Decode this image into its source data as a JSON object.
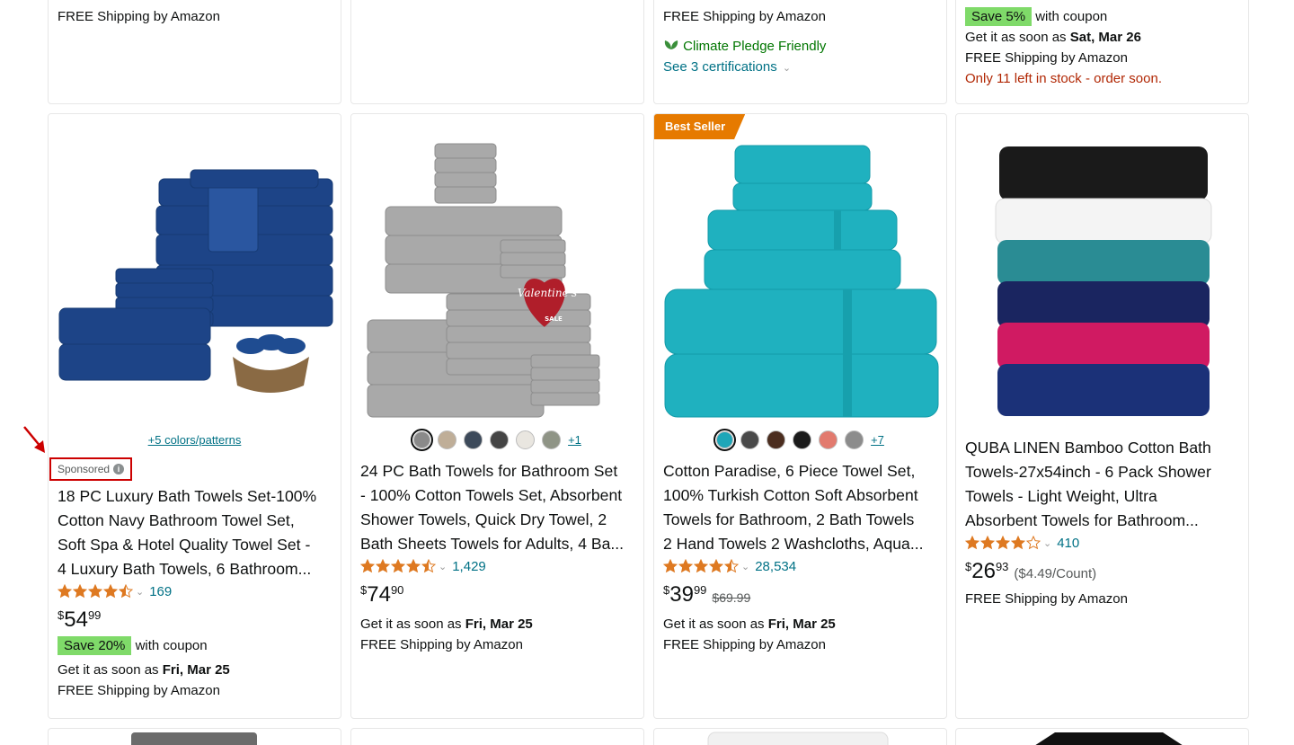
{
  "row0": {
    "c1": {
      "shipping": "FREE Shipping by Amazon"
    },
    "c3": {
      "shipping": "FREE Shipping by Amazon",
      "climate": "Climate Pledge Friendly",
      "certs": "See 3 certifications"
    },
    "c4": {
      "save_badge": "Save 5%",
      "with_coupon": "with coupon",
      "delivery_prefix": "Get it as soon as",
      "delivery_date": "Sat, Mar 26",
      "shipping": "FREE Shipping by Amazon",
      "stock": "Only 11 left in stock - order soon."
    }
  },
  "products": [
    {
      "more_colors": "+5 colors/patterns",
      "sponsored": "Sponsored",
      "title_lines": [
        "18 PC Luxury Bath Towels Set-100%",
        "Cotton Navy Bathroom Towel Set,",
        "Soft Spa & Hotel Quality Towel Set -",
        "4 Luxury Bath Towels, 6 Bathroom..."
      ],
      "rating": 4.5,
      "review_count": "169",
      "price_symbol": "$",
      "price_whole": "54",
      "price_fraction": "99",
      "save_badge": "Save 20%",
      "with_coupon": "with coupon",
      "delivery_prefix": "Get it as soon as",
      "delivery_date": "Fri, Mar 25",
      "shipping": "FREE Shipping by Amazon"
    },
    {
      "swatch_colors": [
        "#8a8a8a",
        "#bfae98",
        "#3d4a5a",
        "#444444",
        "#e9e6e0",
        "#8f9486"
      ],
      "more_swatches": "+1",
      "badge_text": "Valentine's",
      "badge_sale": "SALE",
      "title_lines": [
        "24 PC Bath Towels for Bathroom Set",
        "- 100% Cotton Towels Set, Absorbent",
        "Shower Towels, Quick Dry Towel, 2",
        "Bath Sheets Towels for Adults, 4 Ba..."
      ],
      "rating": 4.5,
      "review_count": "1,429",
      "price_symbol": "$",
      "price_whole": "74",
      "price_fraction": "90",
      "delivery_prefix": "Get it as soon as",
      "delivery_date": "Fri, Mar 25",
      "shipping": "FREE Shipping by Amazon"
    },
    {
      "best_seller": "Best Seller",
      "swatch_colors": [
        "#1ea6b8",
        "#4a4a4a",
        "#4b2d1f",
        "#1a1a1a",
        "#e27a6e",
        "#8c8c8c"
      ],
      "more_swatches": "+7",
      "title_lines": [
        "Cotton Paradise, 6 Piece Towel Set,",
        "100% Turkish Cotton Soft Absorbent",
        "Towels for Bathroom, 2 Bath Towels",
        "2 Hand Towels 2 Washcloths, Aqua..."
      ],
      "rating": 4.5,
      "review_count": "28,534",
      "price_symbol": "$",
      "price_whole": "39",
      "price_fraction": "99",
      "list_price": "$69.99",
      "delivery_prefix": "Get it as soon as",
      "delivery_date": "Fri, Mar 25",
      "shipping": "FREE Shipping by Amazon"
    },
    {
      "title_lines": [
        "QUBA LINEN Bamboo Cotton Bath",
        "Towels-27x54inch - 6 Pack Shower",
        "Towels - Light Weight, Ultra",
        "Absorbent Towels for Bathroom..."
      ],
      "rating": 4.0,
      "review_count": "410",
      "price_symbol": "$",
      "price_whole": "26",
      "price_fraction": "93",
      "unit_price": "($4.49/Count)",
      "shipping": "FREE Shipping by Amazon"
    }
  ],
  "colors": {
    "link": "#007185",
    "star": "#de7921",
    "save_badge": "#7fda69",
    "best_seller": "#e67a00",
    "stock_warning": "#b12704",
    "sponsored_highlight": "#cc0000"
  }
}
